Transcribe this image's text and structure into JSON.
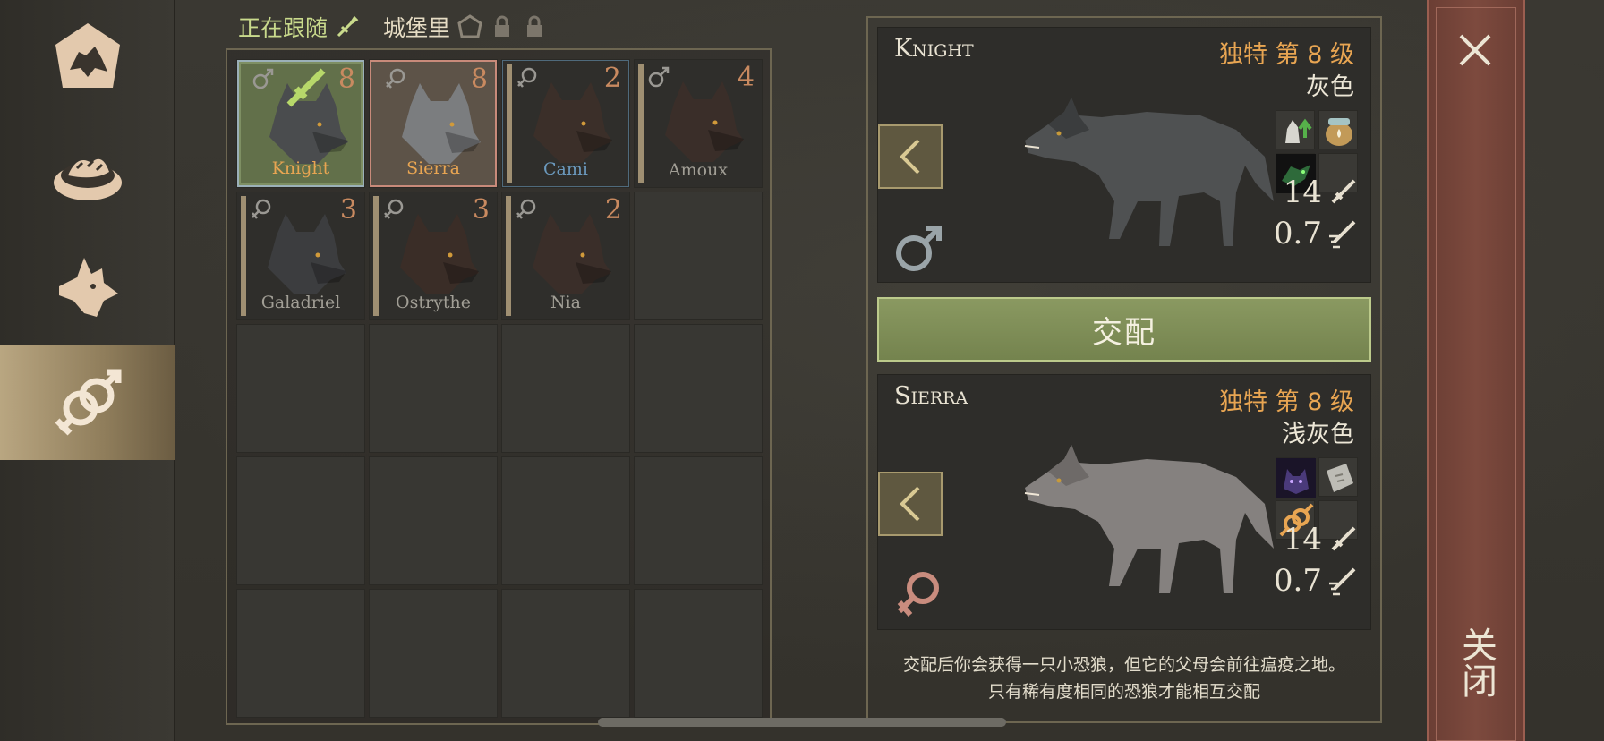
{
  "header": {
    "following_label": "正在跟随",
    "castle_label": "城堡里"
  },
  "nav": {
    "items": [
      {
        "name": "den-icon"
      },
      {
        "name": "food-bowl-icon"
      },
      {
        "name": "wolf-icon"
      },
      {
        "name": "breeding-icon",
        "active": true
      }
    ]
  },
  "wolves": [
    {
      "name": "Knight",
      "level": "8",
      "gender": "male",
      "state": "selected-male",
      "following": true,
      "name_color": "gold",
      "fur": "#4a4c4e"
    },
    {
      "name": "Sierra",
      "level": "8",
      "gender": "female",
      "state": "selected-female",
      "following": false,
      "name_color": "gold",
      "fur": "#7b7d7f"
    },
    {
      "name": "Cami",
      "level": "2",
      "gender": "female",
      "state": "normal",
      "following": false,
      "name_color": "blue",
      "fur": "#3b2f29"
    },
    {
      "name": "Amoux",
      "level": "4",
      "gender": "male",
      "state": "normal",
      "following": false,
      "name_color": "grey",
      "fur": "#3a2e29"
    },
    {
      "name": "Galadriel",
      "level": "3",
      "gender": "female",
      "state": "normal",
      "following": false,
      "name_color": "grey",
      "fur": "#3c3d3f"
    },
    {
      "name": "Ostrythe",
      "level": "3",
      "gender": "female",
      "state": "normal",
      "following": false,
      "name_color": "grey",
      "fur": "#3a2d27"
    },
    {
      "name": "Nia",
      "level": "2",
      "gender": "female",
      "state": "normal",
      "following": false,
      "name_color": "grey",
      "fur": "#3a2e29"
    }
  ],
  "male_panel": {
    "name": "Knight",
    "rarity": "独特 第 8 级",
    "color": "灰色",
    "gender": "male",
    "attack": "14",
    "speed": "0.7",
    "traits": [
      "wolf-growth-icon",
      "honey-jar-icon",
      "green-wolf-icon",
      ""
    ]
  },
  "mate_button_label": "交配",
  "female_panel": {
    "name": "Sierra",
    "rarity": "独特 第 8 级",
    "color": "浅灰色",
    "gender": "female",
    "attack": "14",
    "speed": "0.7",
    "traits": [
      "purple-wolf-icon",
      "stone-tablet-icon",
      "breeding-icon",
      ""
    ]
  },
  "footnote": {
    "line1": "交配后你会获得一只小恐狼，但它的父母会前往瘟疫之地。",
    "line2": "只有稀有度相同的恐狼才能相互交配"
  },
  "close_label": "关闭",
  "colors": {
    "accent_gold": "#e8a552",
    "mate_green": "#7e8d55",
    "close_red": "#7d4a3e",
    "following_green": "#c9da8c"
  }
}
